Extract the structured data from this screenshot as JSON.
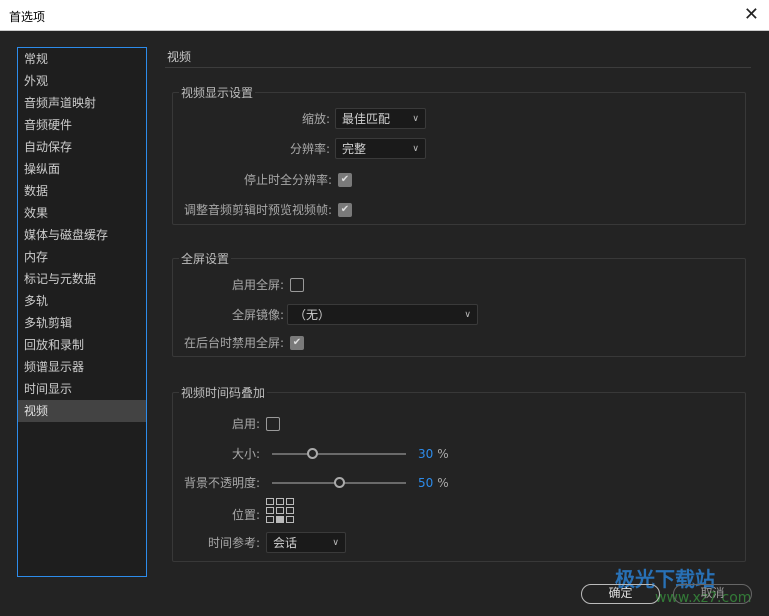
{
  "window": {
    "title": "首选项"
  },
  "sidebar": {
    "items": [
      "常规",
      "外观",
      "音频声道映射",
      "音频硬件",
      "自动保存",
      "操纵面",
      "数据",
      "效果",
      "媒体与磁盘缓存",
      "内存",
      "标记与元数据",
      "多轨",
      "多轨剪辑",
      "回放和录制",
      "频谱显示器",
      "时间显示",
      "视频"
    ],
    "selected": "视频"
  },
  "page": {
    "heading": "视频"
  },
  "video_display": {
    "title": "视频显示设置",
    "zoom_label": "缩放:",
    "zoom_value": "最佳匹配",
    "resolution_label": "分辨率:",
    "resolution_value": "完整",
    "full_res_stopped_label": "停止时全分辨率:",
    "full_res_stopped": true,
    "preview_label": "调整音频剪辑时预览视频帧:",
    "preview": true
  },
  "fullscreen": {
    "title": "全屏设置",
    "enable_label": "启用全屏:",
    "enable": false,
    "mirror_label": "全屏镜像:",
    "mirror_value": "（无）",
    "disable_bg_label": "在后台时禁用全屏:",
    "disable_bg": true
  },
  "timecode": {
    "title": "视频时间码叠加",
    "enable_label": "启用:",
    "enable": false,
    "size_label": "大小:",
    "size_value": "30",
    "opacity_label": "背景不透明度:",
    "opacity_value": "50",
    "percent": "%",
    "position_label": "位置:",
    "position_selected": "bottom-center",
    "timeref_label": "时间参考:",
    "timeref_value": "会话"
  },
  "buttons": {
    "ok": "确定",
    "cancel": "取消"
  },
  "watermark": {
    "text": "极光下载站",
    "url": "www.xz7.com"
  }
}
